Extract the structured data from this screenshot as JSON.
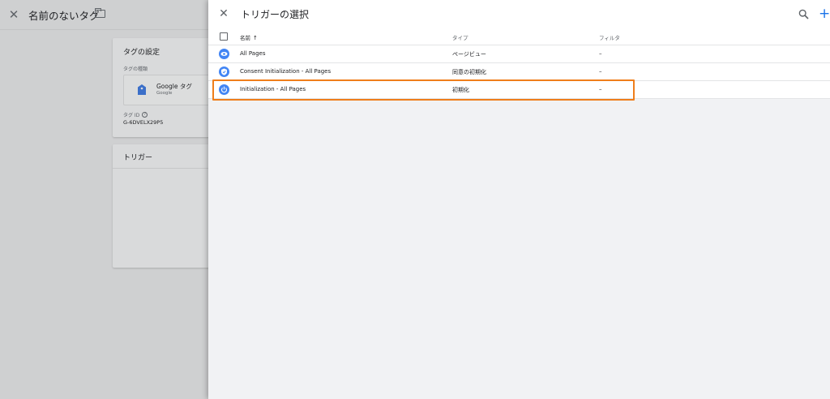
{
  "background": {
    "header": {
      "title": "名前のないタグ"
    },
    "tag_card": {
      "heading": "タグの設定",
      "tag_type_label": "タグの種類",
      "tag_type_name": "Google タグ",
      "tag_type_sub": "Google",
      "tag_id_label": "タグ ID",
      "tag_id_value": "G-6DVELX29P5"
    },
    "trigger_card": {
      "heading": "トリガー"
    }
  },
  "panel": {
    "title": "トリガーの選択",
    "columns": {
      "name": "名前",
      "type": "タイプ",
      "filter": "フィルタ"
    },
    "rows": [
      {
        "name": "All Pages",
        "type": "ページビュー",
        "filter": "–",
        "icon": "eye-icon"
      },
      {
        "name": "Consent Initialization - All Pages",
        "type": "同意の初期化",
        "filter": "–",
        "icon": "consent-shield-icon"
      },
      {
        "name": "Initialization - All Pages",
        "type": "初期化",
        "filter": "–",
        "icon": "power-icon"
      }
    ]
  },
  "colors": {
    "accent": "#1a73e8",
    "trigger_icon": "#4285f4",
    "highlight": "#ef7e1b"
  }
}
